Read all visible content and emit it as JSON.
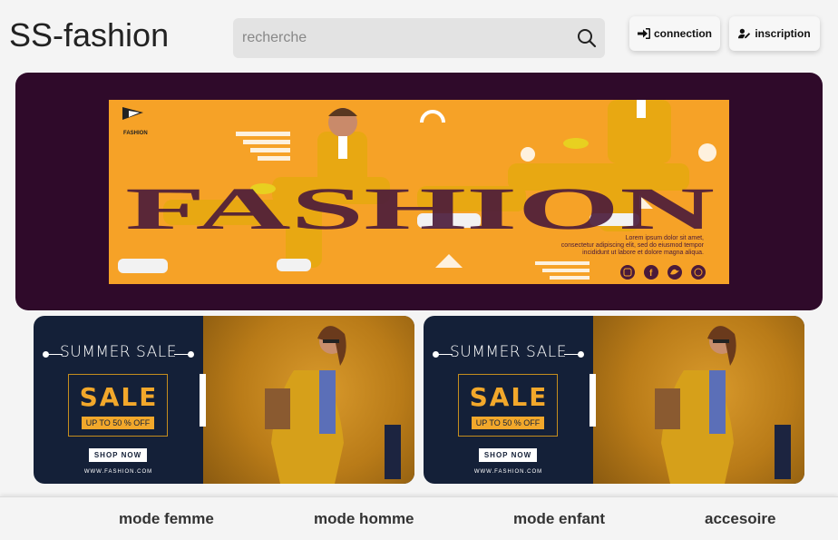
{
  "header": {
    "logo": "SS-fashion",
    "search_placeholder": "recherche",
    "connection_label": "connection",
    "inscription_label": "inscription"
  },
  "hero": {
    "brand_mark": "FASHION",
    "headline": "FASHION",
    "body_line1": "Lorem ipsum dolor sit amet,",
    "body_line2": "consectetur adipiscing elit, sed do eiusmod tempor",
    "body_line3": "incididunt ut labore et dolore magna aliqua.",
    "icons": [
      "instagram-icon",
      "facebook-icon",
      "twitter-icon",
      "whatsapp-icon"
    ],
    "colors": {
      "background": "#2f0a2a",
      "poster": "#f6a227",
      "headline": "#4a1a3a"
    }
  },
  "banners": [
    {
      "title": "SUMMER SALE",
      "sale": "SALE",
      "offer": "UP TO 50 % OFF",
      "cta": "SHOP NOW",
      "website": "WWW.FASHION.COM"
    },
    {
      "title": "SUMMER SALE",
      "sale": "SALE",
      "offer": "UP TO 50 % OFF",
      "cta": "SHOP NOW",
      "website": "WWW.FASHION.COM"
    }
  ],
  "nav": {
    "items": [
      "mode femme",
      "mode homme",
      "mode enfant",
      "accesoire"
    ]
  }
}
